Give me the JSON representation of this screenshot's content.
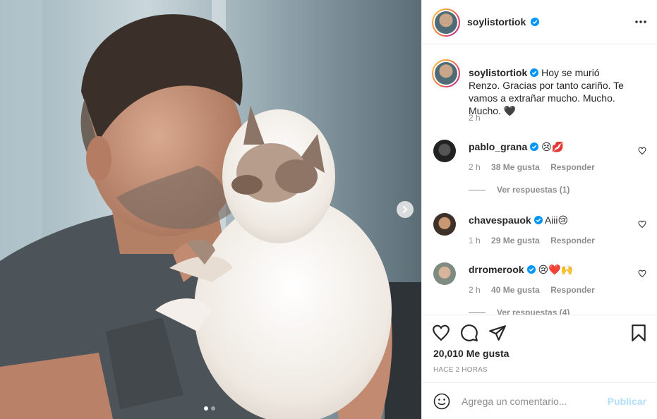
{
  "post": {
    "author": "soylistortiok",
    "verified": true,
    "caption": "Hoy se murió Renzo. Gracias por tanto cariño. Te vamos a extrañar mucho. Mucho. Mucho. 🖤",
    "caption_time": "2 h",
    "likes": "20,010 Me gusta",
    "time_ago": "HACE 2 HORAS",
    "carousel": {
      "current": 1,
      "total": 2
    }
  },
  "comments": [
    {
      "user": "pablo_grana",
      "verified": true,
      "text": "😢💋",
      "time": "2 h",
      "likes": "38 Me gusta",
      "reply": "Responder",
      "replies": "Ver respuestas (1)"
    },
    {
      "user": "chavespauok",
      "verified": true,
      "text": "Aiii😢",
      "time": "1 h",
      "likes": "29 Me gusta",
      "reply": "Responder"
    },
    {
      "user": "drromerook",
      "verified": true,
      "text": "😢❤️🙌",
      "time": "2 h",
      "likes": "40 Me gusta",
      "reply": "Responder",
      "replies": "Ver respuestas (4)"
    }
  ],
  "add_comment": {
    "placeholder": "Agrega un comentario...",
    "publish": "Publicar"
  },
  "icons": {
    "more": "more-options-icon",
    "next": "chevron-right-icon",
    "like": "heart-icon",
    "comment": "comment-bubble-icon",
    "share": "paper-plane-icon",
    "save": "bookmark-icon",
    "emoji": "smiley-icon",
    "verified": "verified-badge-icon"
  },
  "colors": {
    "verified": "#0095f6",
    "publish_disabled": "#b2dffc",
    "muted": "#8e8e8e",
    "text": "#262626"
  }
}
